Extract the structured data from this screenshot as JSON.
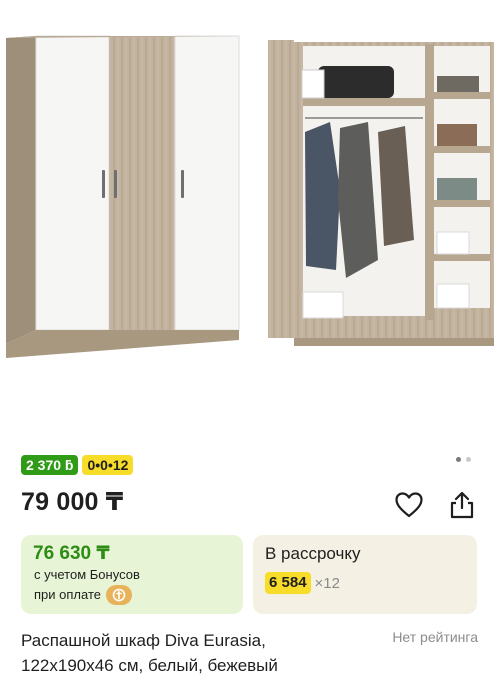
{
  "product": {
    "image_alt": "wardrobe-photo",
    "badges": {
      "bonus": "2 370 ƃ",
      "installment": "0•0•12"
    },
    "price": "79 000 ₸",
    "bonus_card": {
      "price": "76 630 ₸",
      "line1": "с учетом Бонусов",
      "line2": "при оплате"
    },
    "installment_card": {
      "title": "В рассрочку",
      "amount": "6 584",
      "multiplier": "×12"
    },
    "title": "Распашной шкаф Diva Eurasia, 122х190х46 см, белый, бежевый",
    "rating": "Нет рейтинга",
    "icons": {
      "favorite": "heart-icon",
      "share": "share-icon",
      "payment": "kaspi-coin-icon"
    },
    "colors": {
      "bonus_green": "#2f9b17",
      "installment_yellow": "#f7dc2a",
      "bonus_card_bg": "#e7f4d6",
      "installment_card_bg": "#f4f1e4"
    }
  }
}
